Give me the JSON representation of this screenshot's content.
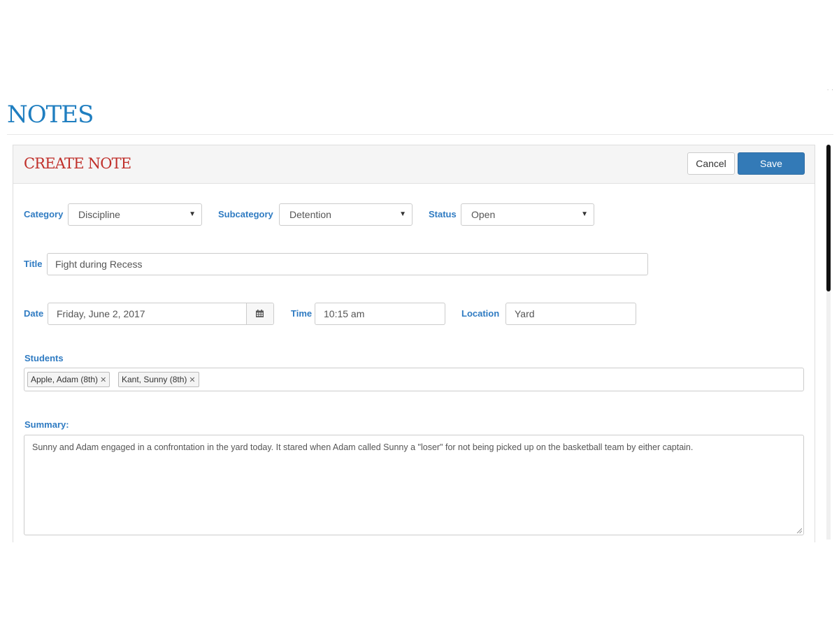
{
  "page": {
    "title": "NOTES",
    "corner_dots": ". ."
  },
  "panel": {
    "title": "CREATE NOTE",
    "cancel_label": "Cancel",
    "save_label": "Save"
  },
  "form": {
    "category": {
      "label": "Category",
      "value": "Discipline"
    },
    "subcategory": {
      "label": "Subcategory",
      "value": "Detention"
    },
    "status": {
      "label": "Status",
      "value": "Open"
    },
    "title": {
      "label": "Title",
      "value": "Fight during Recess"
    },
    "date": {
      "label": "Date",
      "value": "Friday, June 2, 2017"
    },
    "time": {
      "label": "Time",
      "value": "10:15 am"
    },
    "location": {
      "label": "Location",
      "value": "Yard"
    },
    "students": {
      "label": "Students",
      "tags": [
        "Apple, Adam (8th)",
        "Kant, Sunny (8th)"
      ]
    },
    "summary": {
      "label": "Summary:",
      "value": "Sunny and Adam engaged in a confrontation in the yard today. It stared when Adam called Sunny a \"loser\" for not being picked up on the basketball team by either captain."
    }
  },
  "icons": {
    "dropdown": "caret-down-icon",
    "date_picker": "calendar-icon",
    "tag_remove": "close-icon",
    "resize": "resize-grip-icon"
  },
  "colors": {
    "page_title": "#1f7ec0",
    "panel_title": "#c0302b",
    "label": "#2f7bc2",
    "save_button": "#337ab7"
  }
}
